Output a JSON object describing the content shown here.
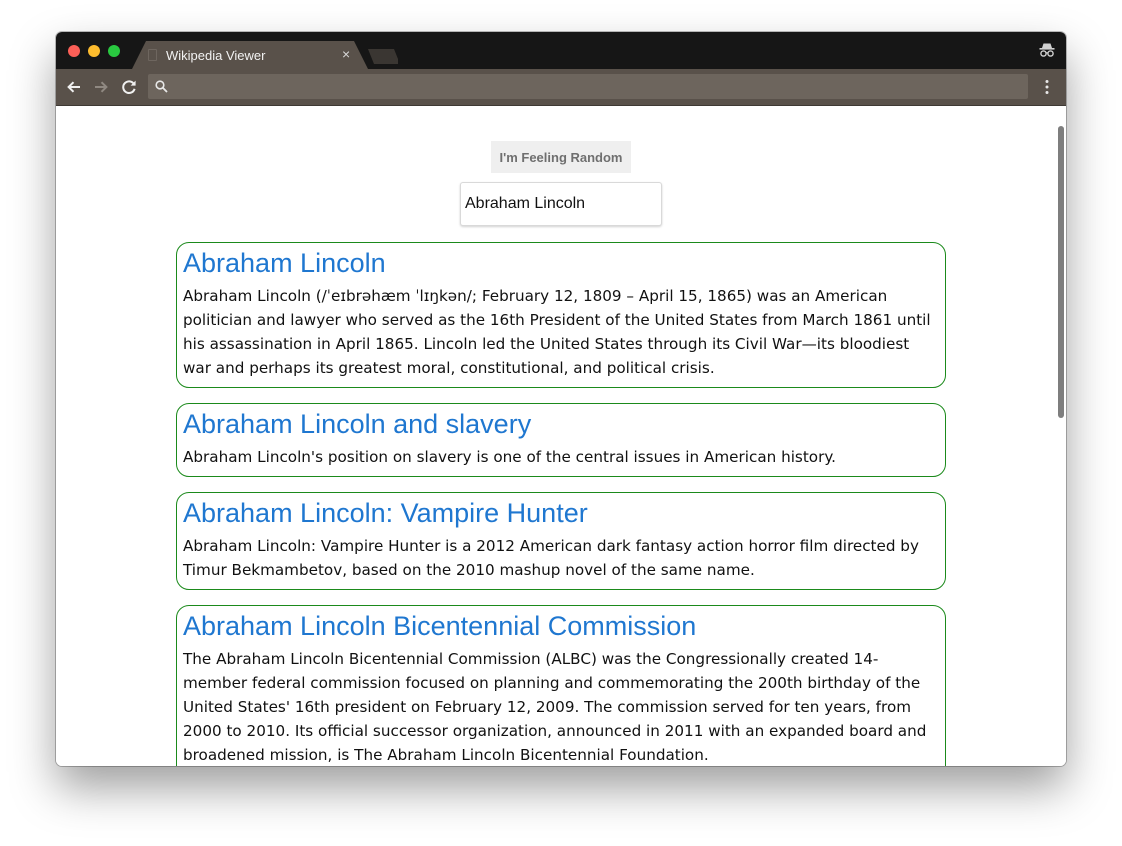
{
  "browser": {
    "tab_title": "Wikipedia Viewer",
    "tab_close": "×",
    "address_value": "",
    "address_placeholder": ""
  },
  "page": {
    "random_button_label": "I'm Feeling Random",
    "search_value": "Abraham Lincoln"
  },
  "results": [
    {
      "title": "Abraham Lincoln",
      "extract": "Abraham Lincoln (/ˈeɪbrəhæm ˈlɪŋkən/; February 12, 1809 – April 15, 1865) was an American politician and lawyer who served as the 16th President of the United States from March 1861 until his assassination in April 1865. Lincoln led the United States through its Civil War—its bloodiest war and perhaps its greatest moral, constitutional, and political crisis."
    },
    {
      "title": "Abraham Lincoln and slavery",
      "extract": "Abraham Lincoln's position on slavery is one of the central issues in American history."
    },
    {
      "title": "Abraham Lincoln: Vampire Hunter",
      "extract": "Abraham Lincoln: Vampire Hunter is a 2012 American dark fantasy action horror film directed by Timur Bekmambetov, based on the 2010 mashup novel of the same name."
    },
    {
      "title": "Abraham Lincoln Bicentennial Commission",
      "extract": "The Abraham Lincoln Bicentennial Commission (ALBC) was the Congressionally created 14-member federal commission focused on planning and commemorating the 200th birthday of the United States' 16th president on February 12, 2009. The commission served for ten years, from 2000 to 2010. Its official successor organization, announced in 2011 with an expanded board and broadened mission, is The Abraham Lincoln Bicentennial Foundation."
    }
  ],
  "colors": {
    "result_title": "#1f77d0",
    "card_border": "#1b8a1b",
    "tab_bar": "#161616",
    "toolbar": "#59514a"
  },
  "icons": [
    "close-icon",
    "incognito-icon",
    "back-arrow-icon",
    "forward-arrow-icon",
    "reload-icon",
    "search-icon",
    "menu-dots-icon"
  ]
}
